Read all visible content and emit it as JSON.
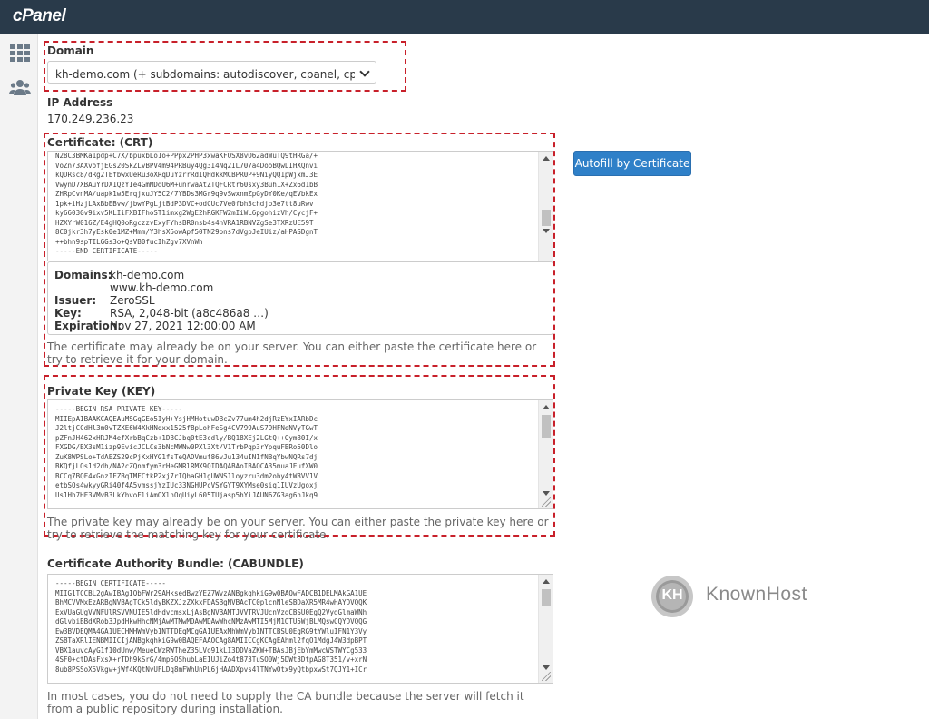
{
  "app": {
    "logo": "cPanel"
  },
  "domain": {
    "label": "Domain",
    "selected": "kh-demo.com    (+ subdomains: autodiscover, cpanel, cpcalendars"
  },
  "ip": {
    "label": "IP Address",
    "value": "170.249.236.23"
  },
  "certificate": {
    "label": "Certificate: (CRT)",
    "lines": [
      "N28C3BMKa1pdp+C7X/bpuxbLo1o+PPpx2PHP3xwaKFOSX8vO62adWuTQ9tHRGa/+",
      "VoZn73AXvofjEGs20SkZLvBPV4m94PRBuy4Qg3I4Nq2IL707a4DooBQwLIHXQnvi",
      "kQDRsc8/dRg2TEfbwxUeRu3oXRqDuYzrrRdIQHdkkMCBPR0P+9NiyQQ1pWjxmJ3E",
      "VwynD7XBAuYrDX1QzYIe4GmMDdU6M+unrwaAtZTQFCRtr60sxy3Buh1X+Zx6d1bB",
      "ZHRpCvnMA/uapk1w5ErqjxuJY5C2/7YBDs3MGr9q9vSwxnmZpGyDY0Ke/qEVbkEx",
      "1pk+iHzjLAxBbEBvw/jbwYPgLjtBdP3DVC+odCUc7Ve0fbh3chdjo3e7tt8uRwv",
      "ky6603Gv9ixv5KLIiFXBIFhoST1imxg2WgE2hRGKFW2mIiWL6pgohizVh/CycjF+",
      "HZXYrW016Z/E4gHQ0oRgczzvExyFYhsBR0nsb4s4nVRA1RBNVZgSe3TXRzUE59T",
      "8C0jkr3h7yEsk0e1MZ+Mmm/Y3hsX6owApf50TN29ons7dVgpJeIUiz/aHPASDgnT",
      "++bhn9spTILGGs3o+QsVB0fucIhZgv7XVnWh",
      "-----END CERTIFICATE-----"
    ],
    "details": {
      "domains_key": "Domains:",
      "domains": [
        "kh-demo.com",
        "www.kh-demo.com"
      ],
      "issuer_key": "Issuer:",
      "issuer": "ZeroSSL",
      "key_key": "Key:",
      "key": "RSA, 2,048-bit (a8c486a8 …)",
      "expiration_key": "Expiration:",
      "expiration": "Nov 27, 2021 12:00:00 AM"
    },
    "help": "The certificate may already be on your server. You can either paste the certificate here or try to retrieve it for your domain.",
    "autofill_label": "Autofill by Certificate"
  },
  "private_key": {
    "label": "Private Key (KEY)",
    "lines": [
      "-----BEGIN RSA PRIVATE KEY-----",
      "MIIEpAIBAAKCAQEAuMSGqGEo5IyH+YsjHMHotuwDBcZv77um4h2djRzEYxIARbDc",
      "J2ltjCCdHl3m0vTZXE6W4XkHNqxx1525fBpLohFeSg4CV799AuS79HFNeNVyTGwT",
      "pZFnJH462xHRJM4efXrbBqCzb+1DBCJbq0tE3cdly/BQ18XEj2LGtQ++Gym80I/x",
      "FXGDG/BX3sM1izp9EvicJCLCs3bNcMWNw0PXl3Xt/V1TrbPqp3rYpquFBRo50Dlo",
      "ZuK8WPSLo+TdAEZS29cPjKxHYG1fsTeQADVmuf86vJu134uIN1fNBqYbwNQRs7dj",
      "BKQfjLOs1d2dh/NA2cZQnmfym3rHeGMRlRMX9QIDAQABAoIBAQCA35muaJEufXW0",
      "BCCq7BQF4xGnzIFZBqTMFCtkP2xj7rIQhaGH1gUWNS1loyzru3dm2ohy4tW8VV1V",
      "etbSQs4wkyyGRi40f4A5vmssjYzIUc33NGHUPcVSYGYT9XYMse0siq1IUVzUgoxj",
      "Us1Hb7HF3VMvB3LkYhvoFliAmOXlnOqUiyL605TUjasp5hYiJAUN6ZG3ag6nJkq9"
    ],
    "help": "The private key may already be on your server. You can either paste the private key here or try to retrieve the matching key for your certificate."
  },
  "cabundle": {
    "label": "Certificate Authority Bundle: (CABUNDLE)",
    "lines": [
      "-----BEGIN CERTIFICATE-----",
      "MIIG1TCCBL2gAwIBAgIQbFWr29AHksedBwzYEZ7WvzANBgkqhkiG9w0BAQwFADCB1DELMAkGA1UE",
      "BhMCVVMxEzARBgNVBAgTCk5ldyBKZXJzZXkxFDASBgNVBAcTC0plcnNleSBDaXR5MR4wHAYDVQQK",
      "ExVUaGUgVVNFUlRSVVNUIE5ldHdvcmsxLjAsBgNVBAMTJVVTRVJUcnVzdCBSU0EgQ2VydGlmaWNh",
      "dGlvbiBBdXRob3JpdHkwHhcNMjAwMTMwMDAwMDAwWhcNMzAwMTI5MjM1OTU5WjBLMQswCQYDVQQG",
      "Ew3BVDEQMA4GA1UECHMHWmVyb1NTTDEqMCgGA1UEAxMhWmVyb1NTTCBSU0EgRG9tYWluIFN1Y3Vy",
      "ZSBTaXRlIENBMIICIjANBgkqhkiG9w0BAQEFAAOCAg8AMIICCgKCAgEAhml2fqO1MdgJ4W3dpBPT",
      "VBX1auvcAyG1f10dUnw/MeueCWzRWTheZ35LVo91kLI3DDVaZKW+TBAsJBjEbYmMwcWSTWYCg533",
      "4SF0+ctDAsFxsX+rTDh9kSrG/4mp6OShubLaEIUJiZo4t873TuSO0Wj5DWt3DtpAG8T351/v+xrN",
      "8ub8PSSoX5Vkgw+jWf4KQtNvUFLDq8mFWhUnPL6jHAADXpvs4lTNYwOtx9yQtbpxwSt7QJY1+ICr"
    ],
    "help": "In most cases, you do not need to supply the CA bundle because the server will fetch it from a public repository during installation."
  },
  "brand": {
    "name": "KnownHost",
    "initials": "KH"
  },
  "colors": {
    "topbar": "#293a4a",
    "primary_button": "#2f80c8",
    "highlight": "#c8202a"
  }
}
